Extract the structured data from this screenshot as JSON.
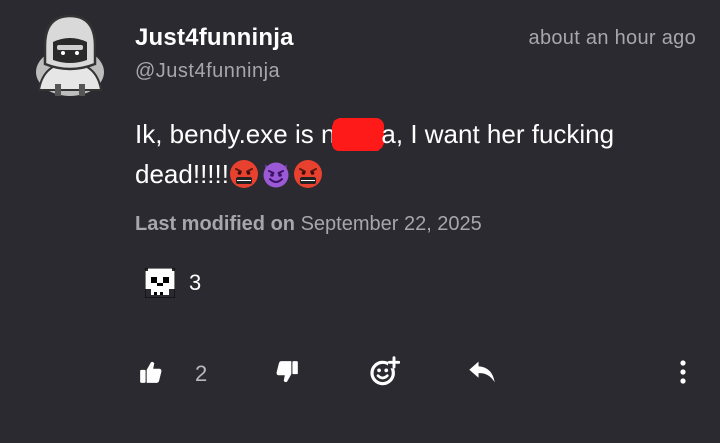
{
  "post": {
    "author_name": "Just4funninja",
    "author_handle": "@Just4funninja",
    "timestamp": "about an hour ago",
    "body": {
      "text_part1": "Ik, bendy.exe is n",
      "text_part2": "a, I want her fucking dead!!!!!",
      "emojis": [
        "enraged-face",
        "smiling-face-with-horns",
        "enraged-face"
      ]
    },
    "modified_label": "Last modified on",
    "modified_date": "September 22, 2025",
    "reaction": {
      "icon": "skull-icon",
      "count": "3"
    },
    "actions": {
      "like_count": "2"
    }
  },
  "colors": {
    "background": "#2b2a30",
    "muted_text": "#a7a6ad",
    "censor_red": "#ff1a1a"
  }
}
